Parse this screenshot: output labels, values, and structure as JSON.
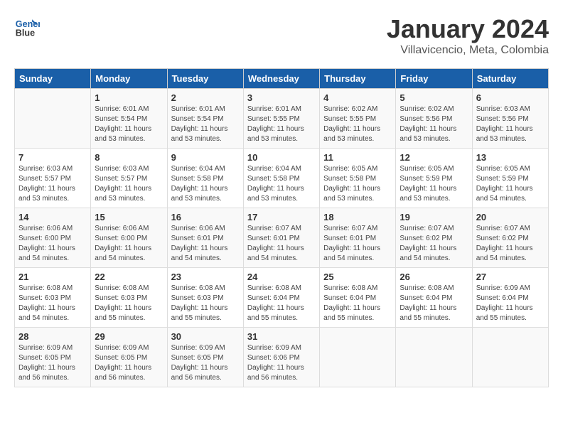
{
  "header": {
    "logo_line1": "General",
    "logo_line2": "Blue",
    "month_title": "January 2024",
    "subtitle": "Villavencio, Meta, Colombia"
  },
  "days_of_week": [
    "Sunday",
    "Monday",
    "Tuesday",
    "Wednesday",
    "Thursday",
    "Friday",
    "Saturday"
  ],
  "weeks": [
    [
      {
        "day": "",
        "info": ""
      },
      {
        "day": "1",
        "info": "Sunrise: 6:01 AM\nSunset: 5:54 PM\nDaylight: 11 hours\nand 53 minutes."
      },
      {
        "day": "2",
        "info": "Sunrise: 6:01 AM\nSunset: 5:54 PM\nDaylight: 11 hours\nand 53 minutes."
      },
      {
        "day": "3",
        "info": "Sunrise: 6:01 AM\nSunset: 5:55 PM\nDaylight: 11 hours\nand 53 minutes."
      },
      {
        "day": "4",
        "info": "Sunrise: 6:02 AM\nSunset: 5:55 PM\nDaylight: 11 hours\nand 53 minutes."
      },
      {
        "day": "5",
        "info": "Sunrise: 6:02 AM\nSunset: 5:56 PM\nDaylight: 11 hours\nand 53 minutes."
      },
      {
        "day": "6",
        "info": "Sunrise: 6:03 AM\nSunset: 5:56 PM\nDaylight: 11 hours\nand 53 minutes."
      }
    ],
    [
      {
        "day": "7",
        "info": "Sunrise: 6:03 AM\nSunset: 5:57 PM\nDaylight: 11 hours\nand 53 minutes."
      },
      {
        "day": "8",
        "info": "Sunrise: 6:03 AM\nSunset: 5:57 PM\nDaylight: 11 hours\nand 53 minutes."
      },
      {
        "day": "9",
        "info": "Sunrise: 6:04 AM\nSunset: 5:58 PM\nDaylight: 11 hours\nand 53 minutes."
      },
      {
        "day": "10",
        "info": "Sunrise: 6:04 AM\nSunset: 5:58 PM\nDaylight: 11 hours\nand 53 minutes."
      },
      {
        "day": "11",
        "info": "Sunrise: 6:05 AM\nSunset: 5:58 PM\nDaylight: 11 hours\nand 53 minutes."
      },
      {
        "day": "12",
        "info": "Sunrise: 6:05 AM\nSunset: 5:59 PM\nDaylight: 11 hours\nand 53 minutes."
      },
      {
        "day": "13",
        "info": "Sunrise: 6:05 AM\nSunset: 5:59 PM\nDaylight: 11 hours\nand 54 minutes."
      }
    ],
    [
      {
        "day": "14",
        "info": "Sunrise: 6:06 AM\nSunset: 6:00 PM\nDaylight: 11 hours\nand 54 minutes."
      },
      {
        "day": "15",
        "info": "Sunrise: 6:06 AM\nSunset: 6:00 PM\nDaylight: 11 hours\nand 54 minutes."
      },
      {
        "day": "16",
        "info": "Sunrise: 6:06 AM\nSunset: 6:01 PM\nDaylight: 11 hours\nand 54 minutes."
      },
      {
        "day": "17",
        "info": "Sunrise: 6:07 AM\nSunset: 6:01 PM\nDaylight: 11 hours\nand 54 minutes."
      },
      {
        "day": "18",
        "info": "Sunrise: 6:07 AM\nSunset: 6:01 PM\nDaylight: 11 hours\nand 54 minutes."
      },
      {
        "day": "19",
        "info": "Sunrise: 6:07 AM\nSunset: 6:02 PM\nDaylight: 11 hours\nand 54 minutes."
      },
      {
        "day": "20",
        "info": "Sunrise: 6:07 AM\nSunset: 6:02 PM\nDaylight: 11 hours\nand 54 minutes."
      }
    ],
    [
      {
        "day": "21",
        "info": "Sunrise: 6:08 AM\nSunset: 6:03 PM\nDaylight: 11 hours\nand 54 minutes."
      },
      {
        "day": "22",
        "info": "Sunrise: 6:08 AM\nSunset: 6:03 PM\nDaylight: 11 hours\nand 55 minutes."
      },
      {
        "day": "23",
        "info": "Sunrise: 6:08 AM\nSunset: 6:03 PM\nDaylight: 11 hours\nand 55 minutes."
      },
      {
        "day": "24",
        "info": "Sunrise: 6:08 AM\nSunset: 6:04 PM\nDaylight: 11 hours\nand 55 minutes."
      },
      {
        "day": "25",
        "info": "Sunrise: 6:08 AM\nSunset: 6:04 PM\nDaylight: 11 hours\nand 55 minutes."
      },
      {
        "day": "26",
        "info": "Sunrise: 6:08 AM\nSunset: 6:04 PM\nDaylight: 11 hours\nand 55 minutes."
      },
      {
        "day": "27",
        "info": "Sunrise: 6:09 AM\nSunset: 6:04 PM\nDaylight: 11 hours\nand 55 minutes."
      }
    ],
    [
      {
        "day": "28",
        "info": "Sunrise: 6:09 AM\nSunset: 6:05 PM\nDaylight: 11 hours\nand 56 minutes."
      },
      {
        "day": "29",
        "info": "Sunrise: 6:09 AM\nSunset: 6:05 PM\nDaylight: 11 hours\nand 56 minutes."
      },
      {
        "day": "30",
        "info": "Sunrise: 6:09 AM\nSunset: 6:05 PM\nDaylight: 11 hours\nand 56 minutes."
      },
      {
        "day": "31",
        "info": "Sunrise: 6:09 AM\nSunset: 6:06 PM\nDaylight: 11 hours\nand 56 minutes."
      },
      {
        "day": "",
        "info": ""
      },
      {
        "day": "",
        "info": ""
      },
      {
        "day": "",
        "info": ""
      }
    ]
  ]
}
